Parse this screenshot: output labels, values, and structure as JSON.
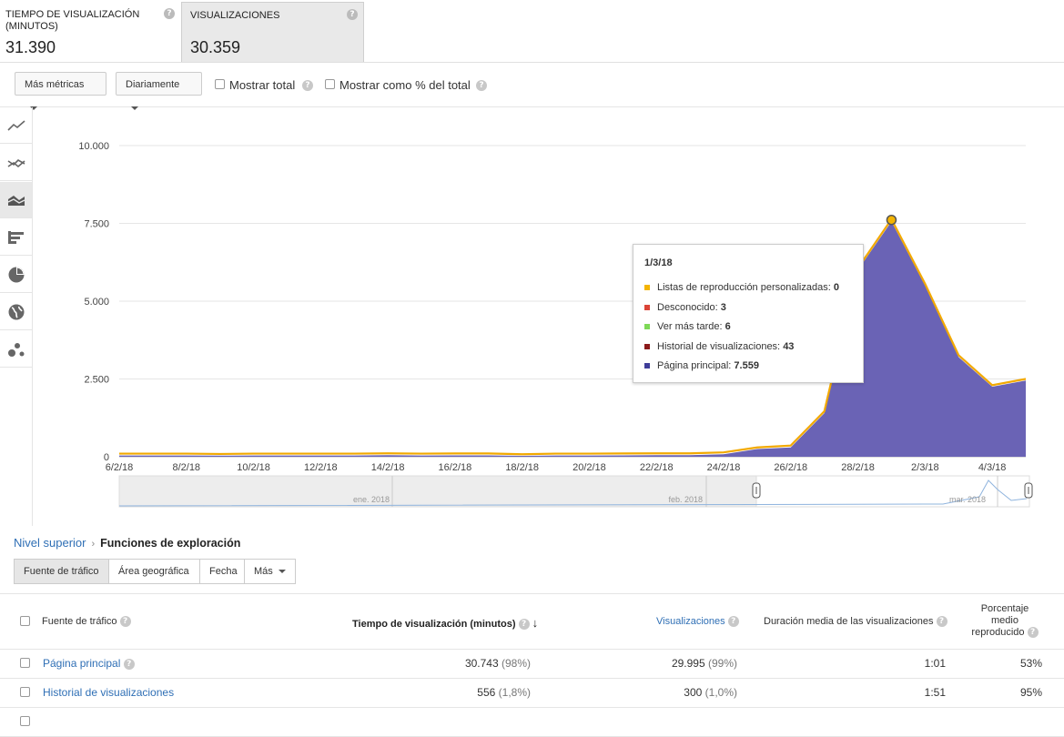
{
  "metrics": [
    {
      "label": "TIEMPO DE VISUALIZACIÓN (MINUTOS)",
      "value": "31.390",
      "help": "?"
    },
    {
      "label": "VISUALIZACIONES",
      "value": "30.359",
      "help": "?"
    }
  ],
  "toolbar": {
    "more_metrics": "Más métricas",
    "interval": "Diariamente",
    "show_total": "Mostrar total",
    "show_pct": "Mostrar como % del total"
  },
  "rail_icons": [
    "line-chart-icon",
    "multi-line-icon",
    "stacked-area-icon",
    "bar-chart-icon",
    "pie-chart-icon",
    "globe-icon",
    "bubble-chart-icon"
  ],
  "chart_data": {
    "type": "area",
    "y_ticks": [
      "10.000",
      "7.500",
      "5.000",
      "2.500",
      "0"
    ],
    "ylim": [
      0,
      10000
    ],
    "x_ticks": [
      "6/2/18",
      "8/2/18",
      "10/2/18",
      "12/2/18",
      "14/2/18",
      "16/2/18",
      "18/2/18",
      "20/2/18",
      "22/2/18",
      "24/2/18",
      "26/2/18",
      "28/2/18",
      "2/3/18",
      "4/3/18"
    ],
    "dates": [
      "6/2/18",
      "7/2/18",
      "8/2/18",
      "9/2/18",
      "10/2/18",
      "11/2/18",
      "12/2/18",
      "13/2/18",
      "14/2/18",
      "15/2/18",
      "16/2/18",
      "17/2/18",
      "18/2/18",
      "19/2/18",
      "20/2/18",
      "21/2/18",
      "22/2/18",
      "23/2/18",
      "24/2/18",
      "25/2/18",
      "26/2/18",
      "27/2/18",
      "28/2/18",
      "1/3/18",
      "2/3/18",
      "3/3/18",
      "4/3/18",
      "5/3/18"
    ],
    "series": [
      {
        "name": "Página principal",
        "color": "#4a44a0",
        "values": [
          40,
          40,
          40,
          35,
          40,
          40,
          40,
          40,
          50,
          40,
          45,
          45,
          30,
          40,
          40,
          45,
          50,
          50,
          80,
          250,
          300,
          1400,
          6000,
          7559,
          5500,
          3200,
          2250,
          2450
        ]
      },
      {
        "name": "Listas de reproducción personalizadas",
        "color": "#f0b400",
        "values": [
          60,
          60,
          60,
          55,
          60,
          60,
          60,
          60,
          60,
          60,
          60,
          60,
          50,
          60,
          60,
          60,
          60,
          60,
          60,
          50,
          60,
          60,
          60,
          73,
          60,
          60,
          50,
          50
        ]
      }
    ],
    "highlight": {
      "date": "1/3/18",
      "value": 7611
    },
    "mini_nav_labels": [
      "ene. 2018",
      "feb. 2018",
      "mar. 2018"
    ]
  },
  "tooltip": {
    "date": "1/3/18",
    "rows": [
      {
        "label": "Listas de reproducción personalizadas:",
        "value": "0",
        "color": "#f4b400"
      },
      {
        "label": "Desconocido:",
        "value": "3",
        "color": "#db4437"
      },
      {
        "label": "Ver más tarde:",
        "value": "6",
        "color": "#7ed957"
      },
      {
        "label": "Historial de visualizaciones:",
        "value": "43",
        "color": "#8b1a1a"
      },
      {
        "label": "Página principal:",
        "value": "7.559",
        "color": "#3f3d99"
      }
    ]
  },
  "breadcrumb": {
    "root": "Nivel superior",
    "sep": "›",
    "current": "Funciones de exploración"
  },
  "tabs": [
    "Fuente de tráfico",
    "Área geográfica",
    "Fecha",
    "Más"
  ],
  "table": {
    "headers": {
      "source": "Fuente de tráfico",
      "watch_time": "Tiempo de visualización (minutos)",
      "views": "Visualizaciones",
      "avg_duration": "Duración media de las visualizaciones",
      "pct_line1": "Porcentaje",
      "pct_line2": "medio",
      "pct_line3": "reproducido"
    },
    "rows": [
      {
        "source": "Página principal",
        "watch_time": "30.743",
        "watch_pct": "(98%)",
        "views": "29.995",
        "views_pct": "(99%)",
        "avg_duration": "1:01",
        "pct_viewed": "53%"
      },
      {
        "source": "Historial de visualizaciones",
        "watch_time": "556",
        "watch_pct": "(1,8%)",
        "views": "300",
        "views_pct": "(1,0%)",
        "avg_duration": "1:51",
        "pct_viewed": "95%"
      }
    ]
  }
}
